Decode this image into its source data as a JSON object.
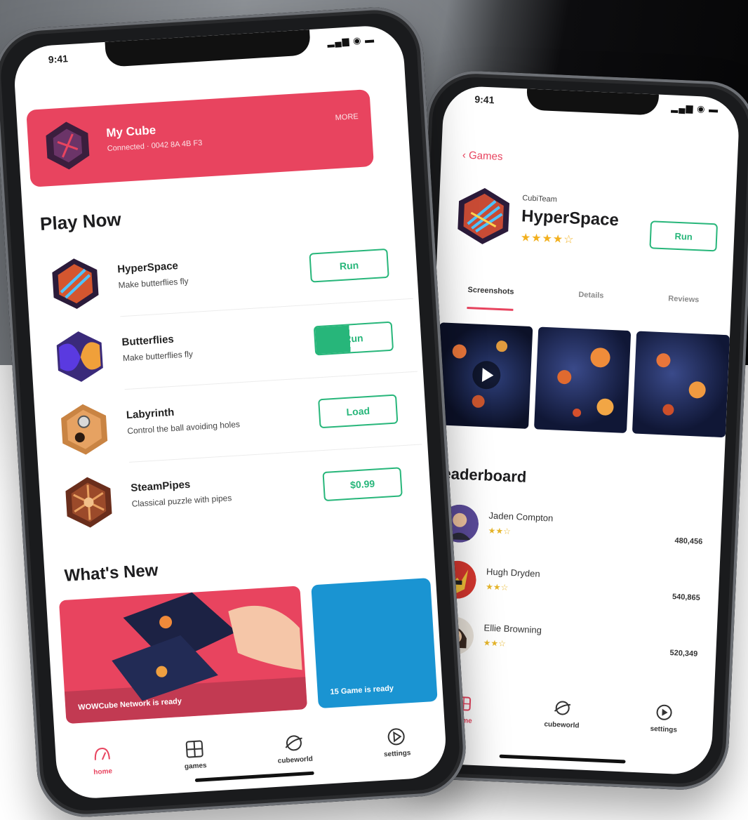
{
  "colors": {
    "accent": "#e8445f",
    "run_green": "#27b67a",
    "star": "#f2b01e"
  },
  "left_phone": {
    "status_time": "9:41",
    "cube": {
      "title": "My Cube",
      "subtitle": "Connected · 0042 8A 4B F3",
      "more": "MORE"
    },
    "play_now_title": "Play Now",
    "games": [
      {
        "name": "HyperSpace",
        "desc": "Make butterflies fly",
        "button": "Run",
        "icon": "hyperspace-icon"
      },
      {
        "name": "Butterflies",
        "desc": "Make butterflies fly",
        "button": "Run",
        "icon": "butterflies-icon"
      },
      {
        "name": "Labyrinth",
        "desc": "Control the ball avoiding holes",
        "button": "Load",
        "icon": "labyrinth-icon"
      },
      {
        "name": "SteamPipes",
        "desc": "Classical puzzle with pipes",
        "button": "$0.99",
        "icon": "steampipes-icon"
      }
    ],
    "whats_new_title": "What's New",
    "news": [
      {
        "caption": "WOWCube Network is ready"
      },
      {
        "caption": "15 Game is ready"
      }
    ],
    "tabs": [
      {
        "label": "home",
        "icon": "home-icon"
      },
      {
        "label": "games",
        "icon": "grid-icon"
      },
      {
        "label": "cubeworld",
        "icon": "planet-icon"
      },
      {
        "label": "settings",
        "icon": "settings-icon"
      }
    ]
  },
  "right_phone": {
    "status_time": "9:41",
    "back_label": "‹ Games",
    "publisher": "CubiTeam",
    "game_title": "HyperSpace",
    "stars": "★★★★☆",
    "run_label": "Run",
    "segments": [
      "Screenshots",
      "Details",
      "Reviews"
    ],
    "leaderboard_title": "Leaderboard",
    "leaderboard": [
      {
        "name": "Jaden Compton",
        "badge": "★★☆",
        "score": "480,456"
      },
      {
        "name": "Hugh Dryden",
        "badge": "★★☆",
        "score": "540,865"
      },
      {
        "name": "Ellie Browning",
        "badge": "★★☆",
        "score": "520,349"
      }
    ],
    "tabs": [
      {
        "label": "home",
        "icon": "home-icon"
      },
      {
        "label": "cubeworld",
        "icon": "planet-icon"
      },
      {
        "label": "settings",
        "icon": "settings-icon"
      }
    ]
  }
}
